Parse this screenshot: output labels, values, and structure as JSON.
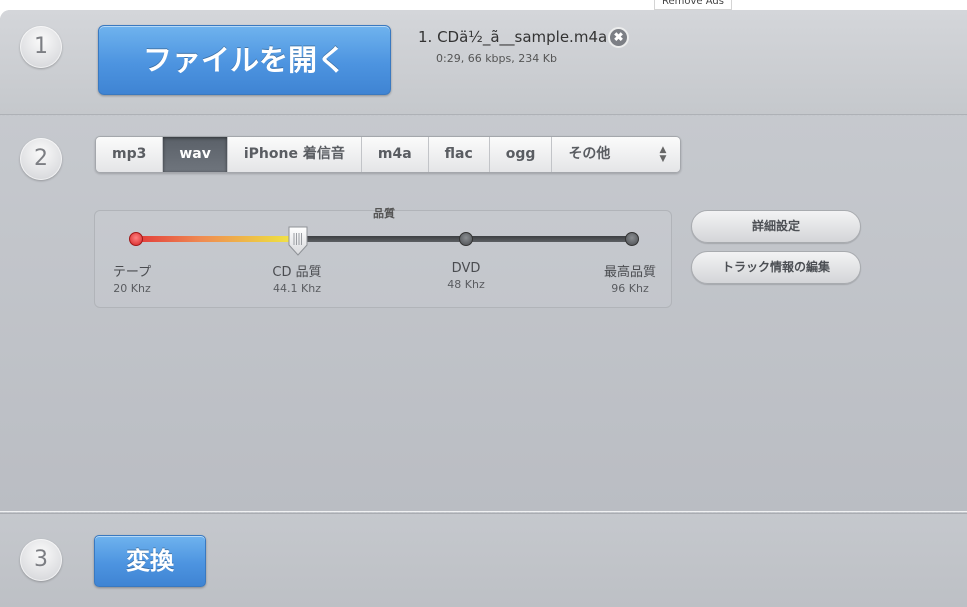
{
  "remove_ads": "Remove Ads",
  "steps": {
    "one": "1",
    "two": "2",
    "three": "3"
  },
  "open_file": {
    "label": "ファイルを開く"
  },
  "file": {
    "name": "1. CDä½_ã__sample.m4a",
    "meta": "0:29, 66 kbps, 234 Kb",
    "remove_icon": "close-icon",
    "remove_glyph": "✖"
  },
  "formats": {
    "items": [
      "mp3",
      "wav",
      "iPhone 着信音",
      "m4a",
      "flac",
      "ogg",
      "その他"
    ],
    "selected": "wav",
    "other_icon": "up-down-arrows-icon"
  },
  "quality": {
    "title": "品質",
    "selected_index": 1,
    "levels": [
      {
        "name": "テープ",
        "freq": "20 Khz"
      },
      {
        "name": "CD 品質",
        "freq": "44.1 Khz"
      },
      {
        "name": "DVD",
        "freq": "48 Khz"
      },
      {
        "name": "最高品質",
        "freq": "96 Khz"
      }
    ]
  },
  "side_buttons": {
    "advanced": "詳細設定",
    "track_info": "トラック情報の編集"
  },
  "convert": {
    "label": "変換"
  },
  "colors": {
    "accent_blue": "#4d94e0",
    "selected_tab": "#5a6068",
    "background": "#c3c6cb"
  }
}
